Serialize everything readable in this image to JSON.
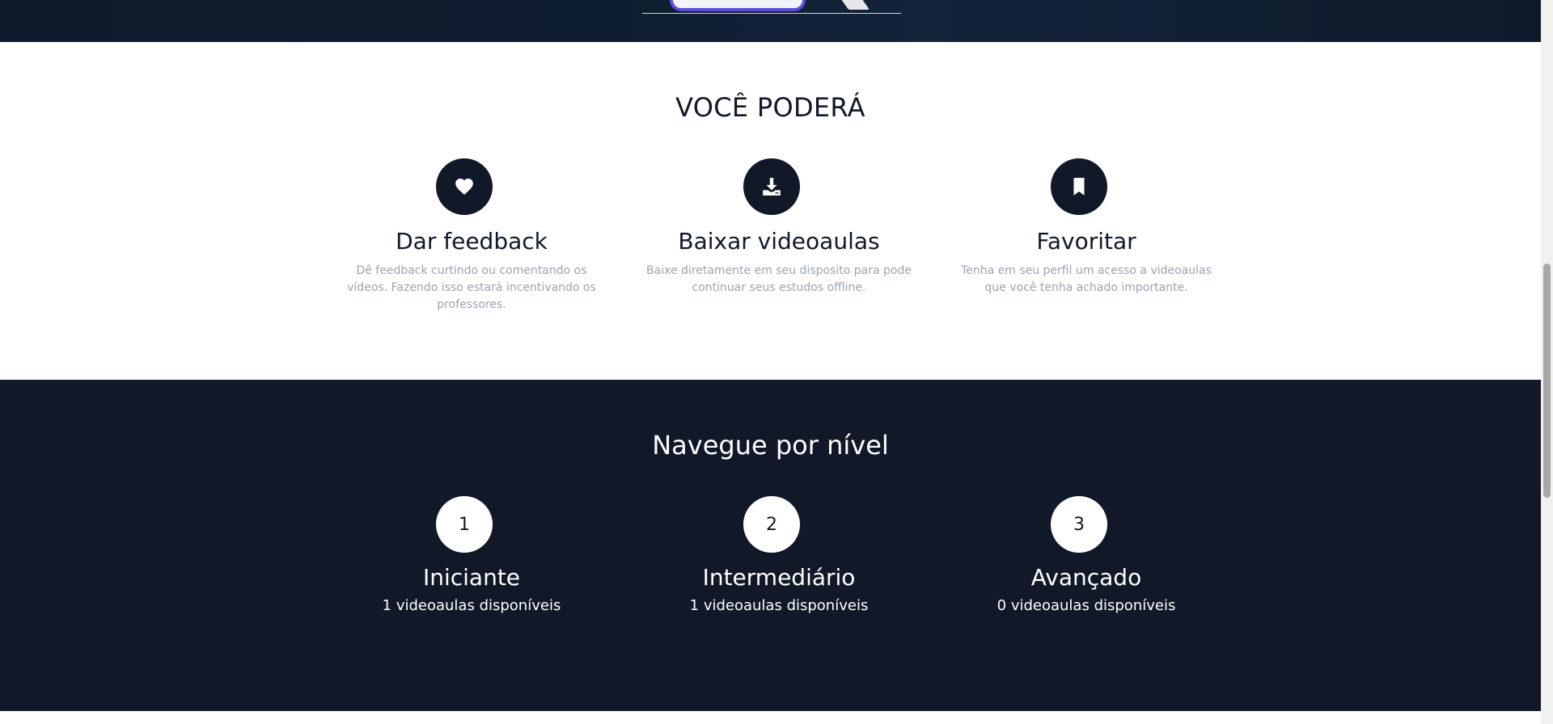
{
  "features": {
    "title": "VOCÊ PODERÁ",
    "items": [
      {
        "icon": "heart-icon",
        "title": "Dar feedback",
        "description": "Dê feedback curtindo ou comentando os vídeos. Fazendo isso estará incentivando os professores."
      },
      {
        "icon": "download-icon",
        "title": "Baixar videoaulas",
        "description": "Baixe diretamente em seu disposito para pode continuar seus estudos offline."
      },
      {
        "icon": "bookmark-icon",
        "title": "Favoritar",
        "description": "Tenha em seu perfil um acesso a videoaulas que você tenha achado importante."
      }
    ]
  },
  "levels": {
    "title": "Navegue por nível",
    "items": [
      {
        "number": "1",
        "name": "Iniciante",
        "count": "1 videoaulas disponíveis"
      },
      {
        "number": "2",
        "name": "Intermediário",
        "count": "1 videoaulas disponíveis"
      },
      {
        "number": "3",
        "name": "Avançado",
        "count": "0 videoaulas disponíveis"
      }
    ]
  },
  "colors": {
    "dark": "#111827",
    "muted": "#9ca3af",
    "accent": "#5b4dde"
  }
}
